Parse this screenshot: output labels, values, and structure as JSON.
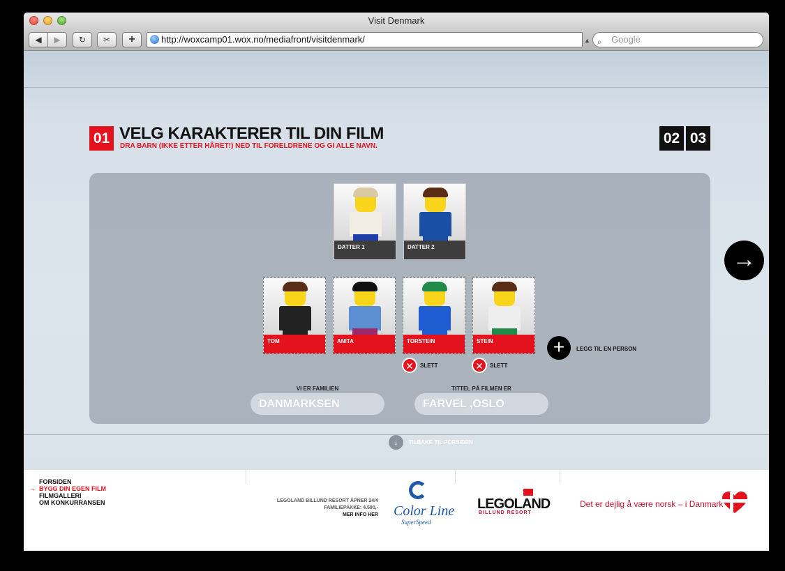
{
  "window": {
    "title": "Visit Denmark"
  },
  "toolbar": {
    "back_icon": "◀",
    "forward_icon": "▶",
    "reload_icon": "↻",
    "snip_icon": "✂",
    "add_icon": "+",
    "url": "http://woxcamp01.wox.no/mediafront/visitdenmark/",
    "search_placeholder": "Google"
  },
  "steps": {
    "current": "01",
    "next": [
      "02",
      "03"
    ]
  },
  "heading": {
    "title": "VELG KARAKTERER TIL DIN FILM",
    "subtitle": "DRA BARN (IKKE ETTER HÅRET!) NED TIL FORELDRENE OG GI ALLE NAVN."
  },
  "children": [
    {
      "label": "DATTER 1",
      "hair": "#d9c9a3",
      "body": "#f2ede4",
      "legs": "#1f3fa8"
    },
    {
      "label": "DATTER 2",
      "hair": "#5a2d16",
      "body": "#1a4fa6",
      "legs": "#1a4fa6"
    }
  ],
  "family": [
    {
      "label": "TOM",
      "hair": "#5a2d16",
      "body": "#222222",
      "legs": "#222222",
      "deletable": false
    },
    {
      "label": "ANITA",
      "hair": "#111111",
      "body": "#5b8fd1",
      "legs": "#9a2a6a",
      "deletable": false
    },
    {
      "label": "TORSTEIN",
      "hair": "#1f8a4a",
      "body": "#1f5bd1",
      "legs": "#1f5bd1",
      "deletable": true
    },
    {
      "label": "STEIN",
      "hair": "#5a2d16",
      "body": "#eeeeee",
      "legs": "#1f8a4a",
      "deletable": true
    }
  ],
  "delete_label": "SLETT",
  "delete_icon": "✕",
  "add_person": {
    "icon": "+",
    "label": "LEGG TIL EN PERSON"
  },
  "fields": {
    "family_label": "VI ER FAMILIEN",
    "family_value": "DANMARKSEN",
    "title_label": "TITTEL PÅ FILMEN ER",
    "title_value": "FARVEL ,OSLO"
  },
  "next_icon": "→",
  "back_link": {
    "icon": "↓",
    "label": "TILBAKE TIL FORSIDEN"
  },
  "footer": {
    "nav": [
      "FORSIDEN",
      "BYGG DIN EGEN FILM",
      "FILMGALLERI",
      "OM KONKURRANSEN"
    ],
    "nav_arrow": "→",
    "promo_line1": "LEGOLAND BILLUND RESORT ÅPNER 24/4",
    "promo_line2": "FAMILIEPAKKE: 4.580,-",
    "promo_link": "MER INFO HER",
    "colorline": "Color Line",
    "colorline_sub": "SuperSpeed",
    "legoland": "LEGOLAND",
    "legoland_sub": "BILLUND RESORT",
    "tagline": "Det er dejlig å være norsk – i Danmark"
  },
  "colors": {
    "accent": "#e4121d",
    "dark": "#111111",
    "brand_blue": "#1e5aa8"
  }
}
